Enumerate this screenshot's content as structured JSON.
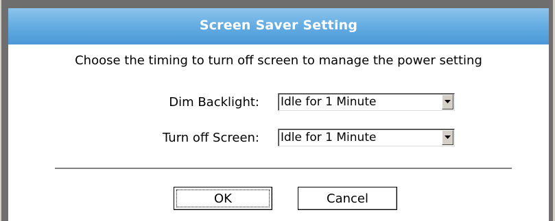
{
  "dialog": {
    "title": "Screen Saver Setting",
    "instruction": "Choose the timing to turn off screen to manage the power setting",
    "settings": [
      {
        "label": "Dim Backlight:",
        "value": "Idle for 1 Minute"
      },
      {
        "label": "Turn off Screen:",
        "value": "Idle for 1 Minute"
      }
    ],
    "buttons": {
      "ok": "OK",
      "cancel": "Cancel"
    }
  },
  "colors": {
    "titlebar": "#67aee3",
    "frame": "#6e6e6e",
    "divider": "#808080"
  },
  "icons": {
    "dropdown": "chevron-down-icon"
  }
}
